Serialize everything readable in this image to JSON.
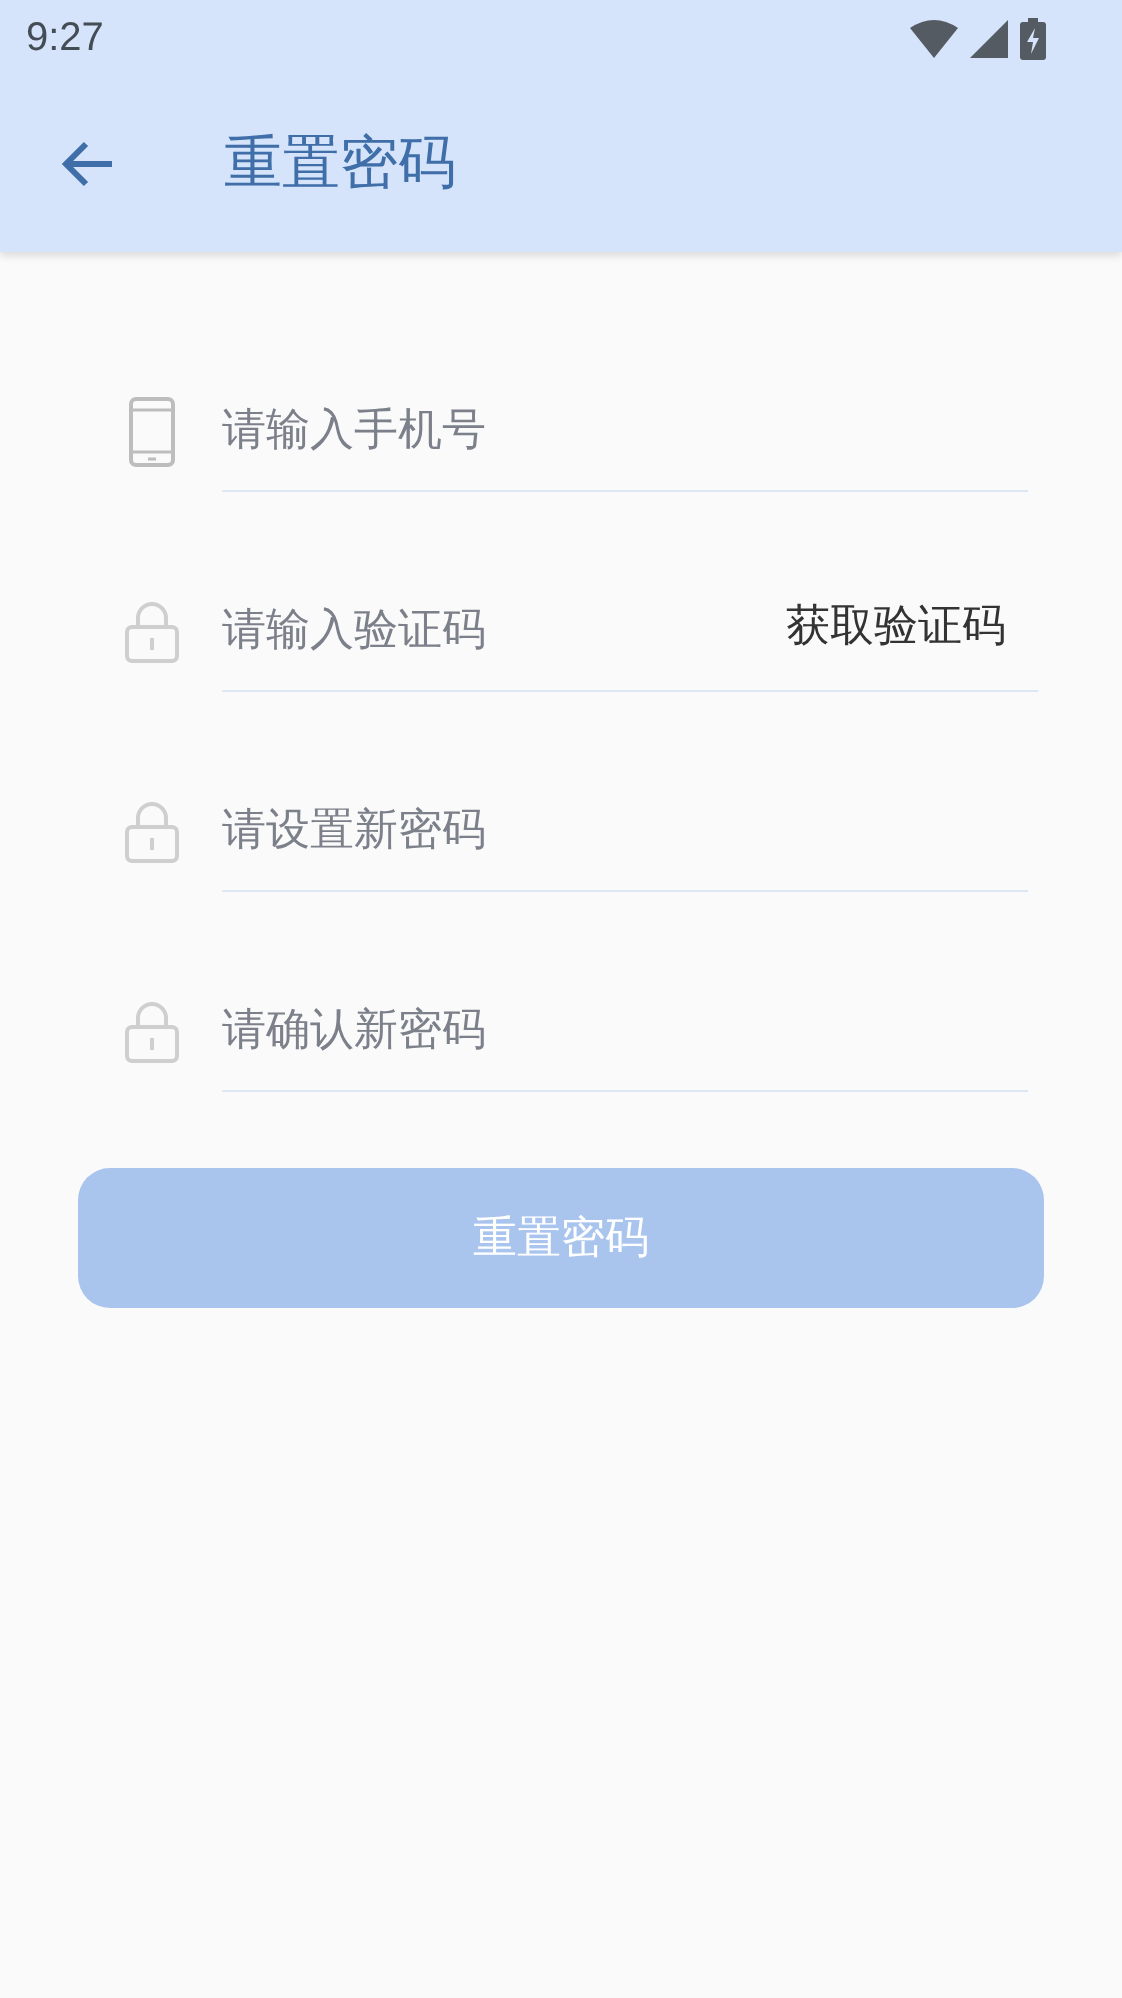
{
  "status_bar": {
    "time": "9:27"
  },
  "app_bar": {
    "title": "重置密码"
  },
  "fields": [
    {
      "kind": "phone",
      "placeholder": "请输入手机号"
    },
    {
      "kind": "lock",
      "placeholder": "请输入验证码",
      "action": "获取验证码"
    },
    {
      "kind": "lock",
      "placeholder": "请设置新密码"
    },
    {
      "kind": "lock",
      "placeholder": "请确认新密码"
    }
  ],
  "submit": {
    "label": "重置密码",
    "disabled": true
  }
}
